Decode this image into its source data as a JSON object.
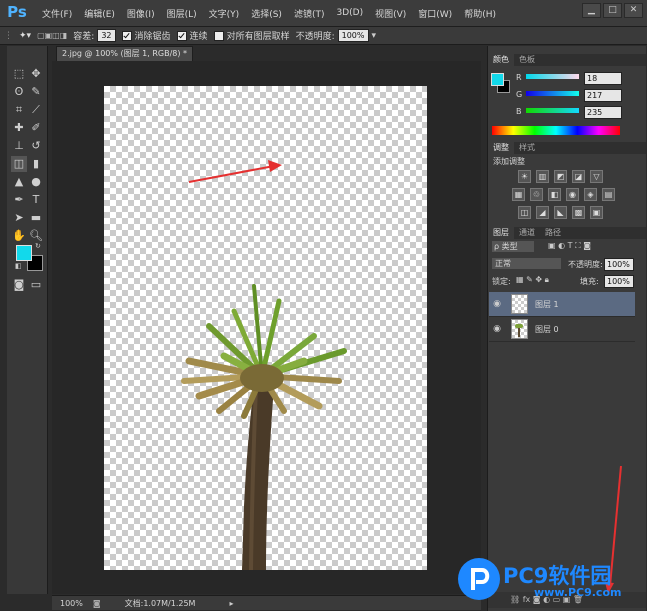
{
  "app": {
    "logo": "Ps"
  },
  "menu": [
    "文件(F)",
    "编辑(E)",
    "图像(I)",
    "图层(L)",
    "文字(Y)",
    "选择(S)",
    "滤镜(T)",
    "3D(D)",
    "视图(V)",
    "窗口(W)",
    "帮助(H)"
  ],
  "window_controls": {
    "minimize": "▁",
    "restore": "□",
    "close": "✕"
  },
  "options": {
    "hardness_label": "容差:",
    "hardness_value": "32",
    "anti_alias_label": "消除锯齿",
    "contiguous_label": "连续",
    "sample_all_label": "对所有图层取样",
    "opacity_label": "不透明度:",
    "opacity_value": "100%"
  },
  "document": {
    "tab_title": "2.jpg @ 100% (图层 1, RGB/8) *",
    "zoom": "100%",
    "doc_info": "文档:1.07M/1.25M"
  },
  "color_panel": {
    "tabs": [
      "颜色",
      "色板"
    ],
    "r_label": "R",
    "g_label": "G",
    "b_label": "B",
    "r_value": "18",
    "g_value": "217",
    "b_value": "235",
    "foreground": "#12d9eb",
    "background": "#000000"
  },
  "adjust_panel": {
    "tabs": [
      "调整",
      "样式"
    ],
    "title": "添加调整",
    "row1": [
      "☀",
      "▥",
      "◩",
      "◪",
      "▽"
    ],
    "row2": [
      "▦",
      "♲",
      "◧",
      "◉",
      "◈",
      "▤"
    ],
    "row3": [
      "◫",
      "◢",
      "◣",
      "▩",
      "▣"
    ]
  },
  "layers_panel": {
    "tabs": [
      "图层",
      "通道",
      "路径"
    ],
    "filter_label": "ρ 类型",
    "blend_mode": "正常",
    "opacity_label": "不透明度:",
    "opacity_value": "100%",
    "lock_label": "锁定:",
    "fill_label": "填充:",
    "fill_value": "100%",
    "layers": [
      {
        "name": "图层 1",
        "selected": true
      },
      {
        "name": "图层 0",
        "selected": false
      }
    ]
  },
  "watermark": {
    "text": "PC9软件园",
    "url": "www.PC9.com"
  },
  "colors": {
    "accent_arrow": "#e53030",
    "watermark": "#1e88ff"
  }
}
